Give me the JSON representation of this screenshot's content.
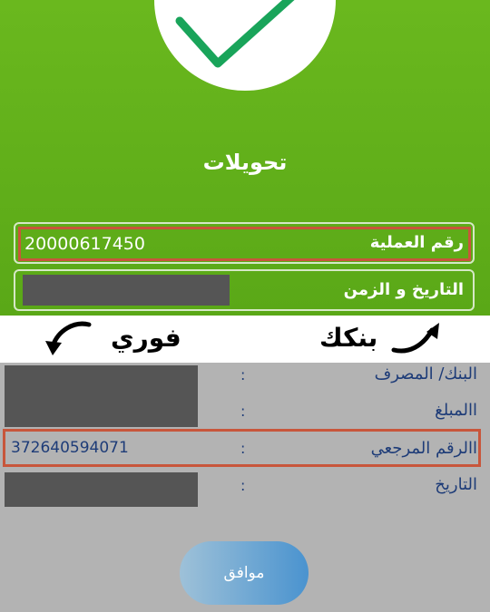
{
  "header": {
    "title": "تحويلات"
  },
  "fields": {
    "transaction_label": "رقم العملية",
    "transaction_value": "20000617450",
    "datetime_label": "التاريخ و الزمن"
  },
  "annotations": {
    "right_word": "بنكك",
    "left_word": "فوري"
  },
  "details": {
    "bank_label": "البنك/ المصرف",
    "amount_label": "االمبلغ",
    "reference_label": "االرقم المرجعي",
    "reference_value": "372640594071",
    "date_label": "التاريخ",
    "colon": ":"
  },
  "actions": {
    "ok_label": "موافق"
  },
  "colors": {
    "header_green": "#5fae1b",
    "check_green": "#19a45a",
    "highlight_red": "#c8563b",
    "label_blue": "#1e3c78"
  }
}
